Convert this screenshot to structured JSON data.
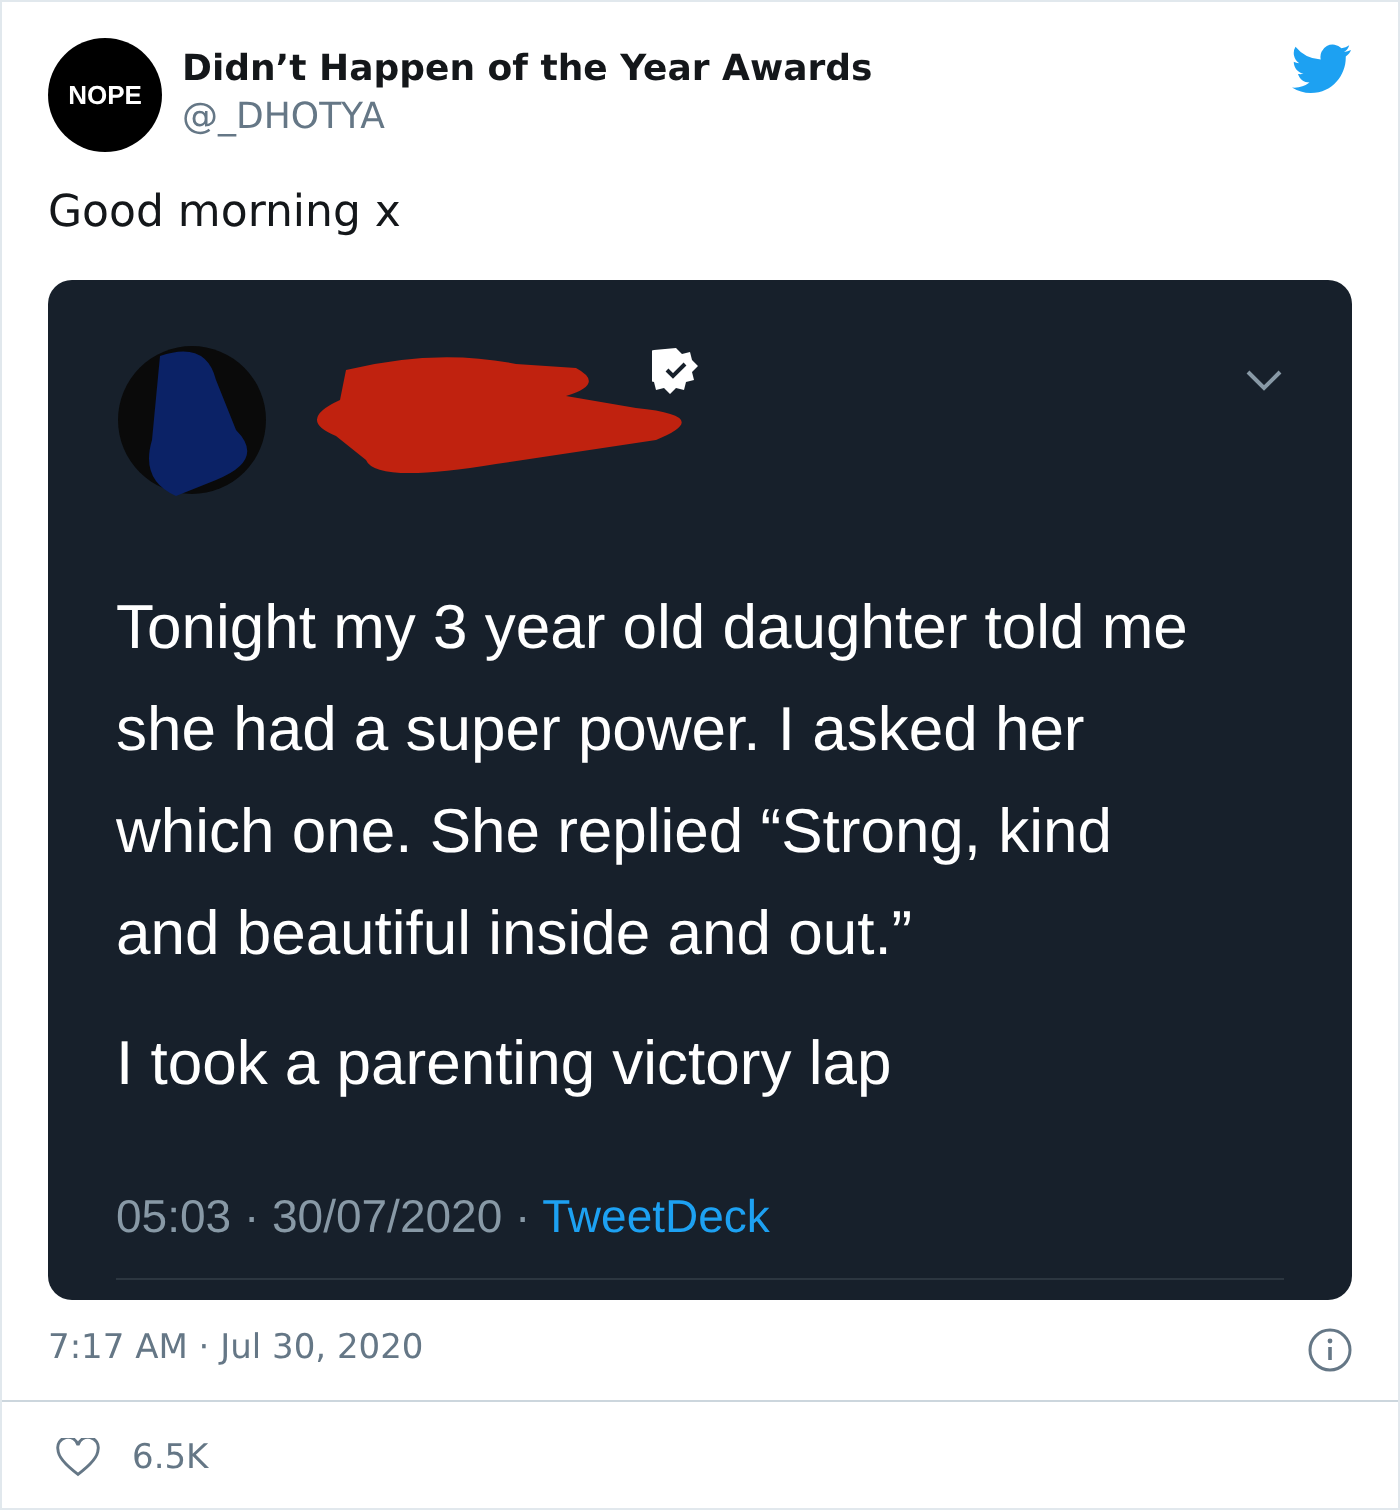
{
  "author": {
    "avatar_text": "NOPE",
    "name": "Didn’t Happen of the Year Awards",
    "handle": "@_DHOTYA"
  },
  "text": "Good morning x",
  "embedded": {
    "verified": true,
    "paragraphs": [
      "Tonight my 3 year old daughter told me she had a super power.  I asked her which one.  She replied “Strong, kind and beautiful inside and out.”",
      "I took a parenting victory lap"
    ],
    "meta": "05:03 · 30/07/2020 · ",
    "source": "TweetDeck"
  },
  "timestamp": "7:17 AM · Jul 30, 2020",
  "likes": "6.5K"
}
